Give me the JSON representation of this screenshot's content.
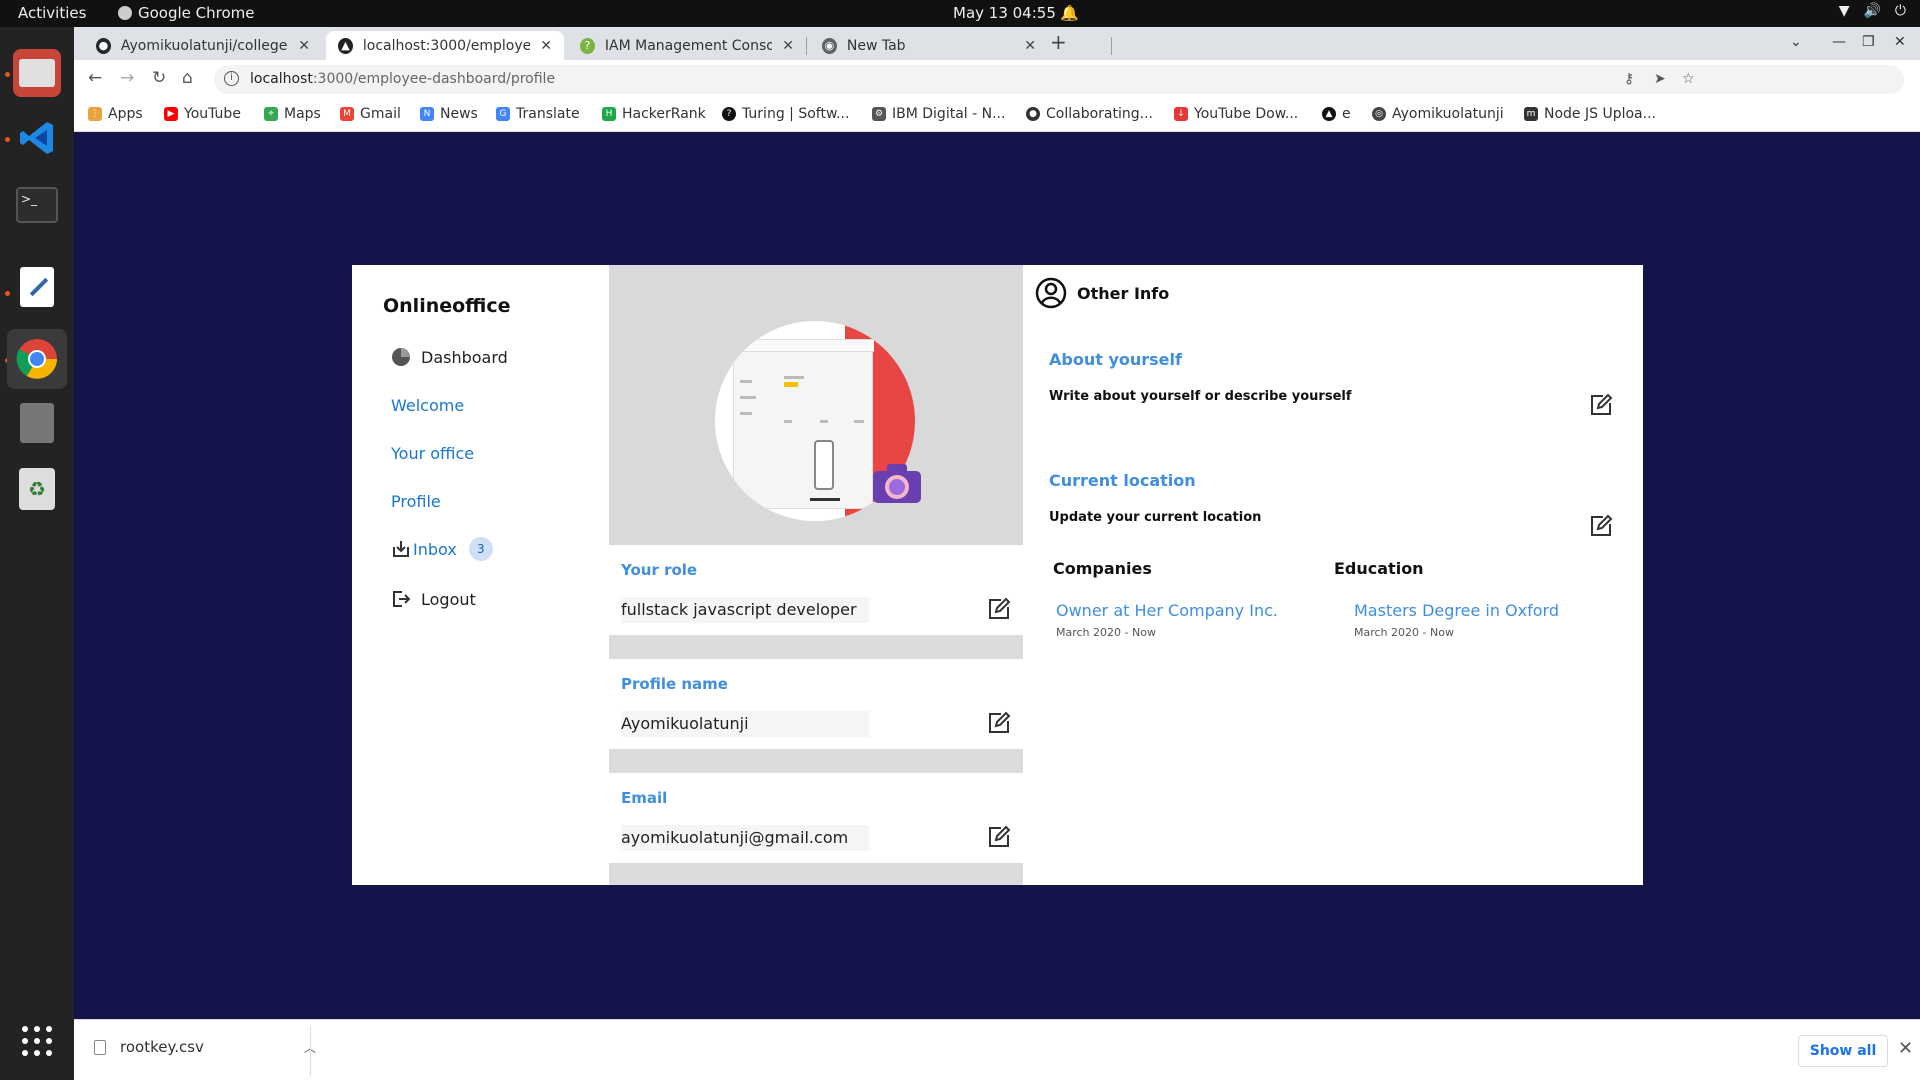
{
  "topbar": {
    "activities": "Activities",
    "app_name": "Google Chrome",
    "clock": "May 13  04:55"
  },
  "tabs": [
    {
      "title": "Ayomikuolatunji/college",
      "icon": "github-icon"
    },
    {
      "title": "localhost:3000/employee",
      "icon": "react-icon"
    },
    {
      "title": "IAM Management Consol",
      "icon": "aws-icon"
    },
    {
      "title": "New Tab",
      "icon": "chrome-icon"
    }
  ],
  "omnibox": {
    "host": "localhost",
    "path": ":3000/employee-dashboard/profile"
  },
  "bookmarks": [
    {
      "label": "Apps",
      "color": "#e8a33d"
    },
    {
      "label": "YouTube",
      "color": "#ff0000"
    },
    {
      "label": "Maps",
      "color": "#34a853"
    },
    {
      "label": "Gmail",
      "color": "#ea4335"
    },
    {
      "label": "News",
      "color": "#4285f4"
    },
    {
      "label": "Translate",
      "color": "#4285f4"
    },
    {
      "label": "HackerRank",
      "color": "#1ba94c"
    },
    {
      "label": "Turing | Softw...",
      "color": "#111111"
    },
    {
      "label": "IBM Digital - N...",
      "color": "#555555"
    },
    {
      "label": "Collaborating...",
      "color": "#333333"
    },
    {
      "label": "YouTube Dow...",
      "color": "#e53935"
    },
    {
      "label": "e",
      "color": "#111111"
    },
    {
      "label": "Ayomikuolatunji",
      "color": "#444444"
    },
    {
      "label": "Node JS Uploa...",
      "color": "#333333"
    }
  ],
  "sidebar": {
    "brand": "Onlineoffice",
    "dashboard": "Dashboard",
    "welcome": "Welcome",
    "office": "Your office",
    "profile": "Profile",
    "inbox": "Inbox",
    "inbox_count": "3",
    "logout": "Logout"
  },
  "profile": {
    "role_label": "Your role",
    "role_value": "fullstack javascript developer",
    "name_label": "Profile name",
    "name_value": "Ayomikuolatunji",
    "email_label": "Email",
    "email_value": "ayomikuolatunji@gmail.com"
  },
  "other": {
    "heading": "Other Info",
    "about_label": "About yourself",
    "about_text": "Write about yourself or describe yourself",
    "location_label": "Current location",
    "location_text": "Update your current location",
    "companies_title": "Companies",
    "company_name": "Owner at Her Company Inc.",
    "company_date": "March 2020 - Now",
    "education_title": "Education",
    "education_name": "Masters Degree in Oxford",
    "education_date": "March 2020 - Now"
  },
  "shelf": {
    "file": "rootkey.csv",
    "show_all": "Show all"
  },
  "colors": {
    "accent": "#3f8ee0",
    "page_bg": "#14144a",
    "link": "#1976d2"
  }
}
